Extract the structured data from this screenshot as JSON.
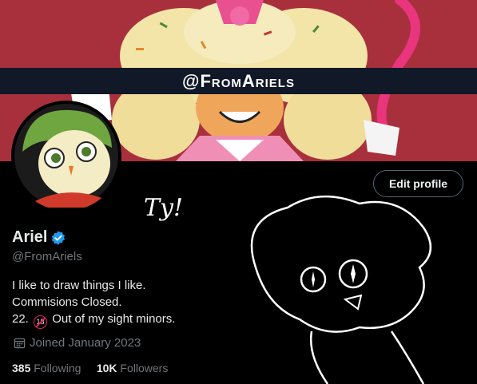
{
  "banner": {
    "handle_text": "@FromAriels"
  },
  "profile": {
    "edit_label": "Edit profile",
    "name": "Ariel",
    "handle": "@FromAriels",
    "bio": [
      "I like to draw things I like.",
      "Commisions Closed.",
      "22.",
      "Out of my sight minors."
    ],
    "age_badge": "18",
    "joined": "Joined January 2023",
    "following_count": "385",
    "following_label": "Following",
    "followers_count": "10K",
    "followers_label": "Followers"
  },
  "drawing": {
    "caption": "Ty!"
  },
  "colors": {
    "verified": "#1d9bf0",
    "banner_bg": "#a8303d",
    "secondary_text": "#71767b"
  },
  "icons": [
    "verified-badge-icon",
    "calendar-icon",
    "age-18-icon"
  ]
}
